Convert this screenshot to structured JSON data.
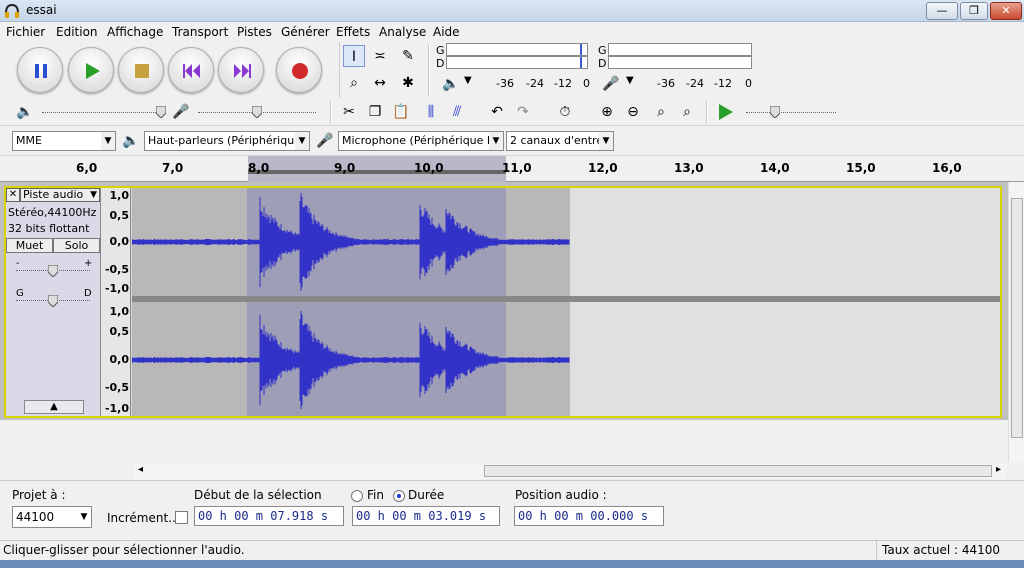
{
  "window": {
    "title": "essai",
    "minimize": "—",
    "maximize": "❐",
    "close": "✕"
  },
  "menu": [
    "Fichier",
    "Edition",
    "Affichage",
    "Transport",
    "Pistes",
    "Générer",
    "Effets",
    "Analyse",
    "Aide"
  ],
  "meters": {
    "left_label": "G",
    "right_label": "D",
    "scale": [
      "-36",
      "-24",
      "-12",
      "0"
    ]
  },
  "devices": {
    "host": "MME",
    "output": "Haut-parleurs (Périphérique Hi",
    "input": "Microphone (Périphérique High",
    "channels": "2 canaux d'entrée"
  },
  "ruler": {
    "ticks": [
      "6,0",
      "7,0",
      "8,0",
      "9,0",
      "10,0",
      "11,0",
      "12,0",
      "13,0",
      "14,0",
      "15,0",
      "16,0"
    ]
  },
  "track": {
    "name": "Piste audio",
    "close": "✕",
    "format": "Stéréo,44100Hz",
    "bits": "32 bits flottant",
    "mute": "Muet",
    "solo": "Solo",
    "gain_minus": "-",
    "gain_plus": "+",
    "pan_left": "G",
    "pan_right": "D",
    "scale": [
      "1,0",
      "0,5",
      "0,0",
      "-0,5",
      "-1,0"
    ]
  },
  "selection_bar": {
    "project_rate_label": "Projet à :",
    "project_rate": "44100",
    "snap_label": "Incrément...",
    "selection_start_label": "Début de la sélection",
    "end_label": "Fin",
    "duration_label": "Durée",
    "audio_position_label": "Position audio :",
    "selection_start": "00 h 00 m 07.918 s",
    "duration": "00 h 00 m 03.019 s",
    "audio_position": "00 h 00 m 00.000 s"
  },
  "status": {
    "left": "Cliquer-glisser pour sélectionner l'audio.",
    "right": "Taux actuel : 44100"
  },
  "colors": {
    "waveform": "#3232c8",
    "selection": "#a0a0b8",
    "background": "#f0f0f0"
  }
}
